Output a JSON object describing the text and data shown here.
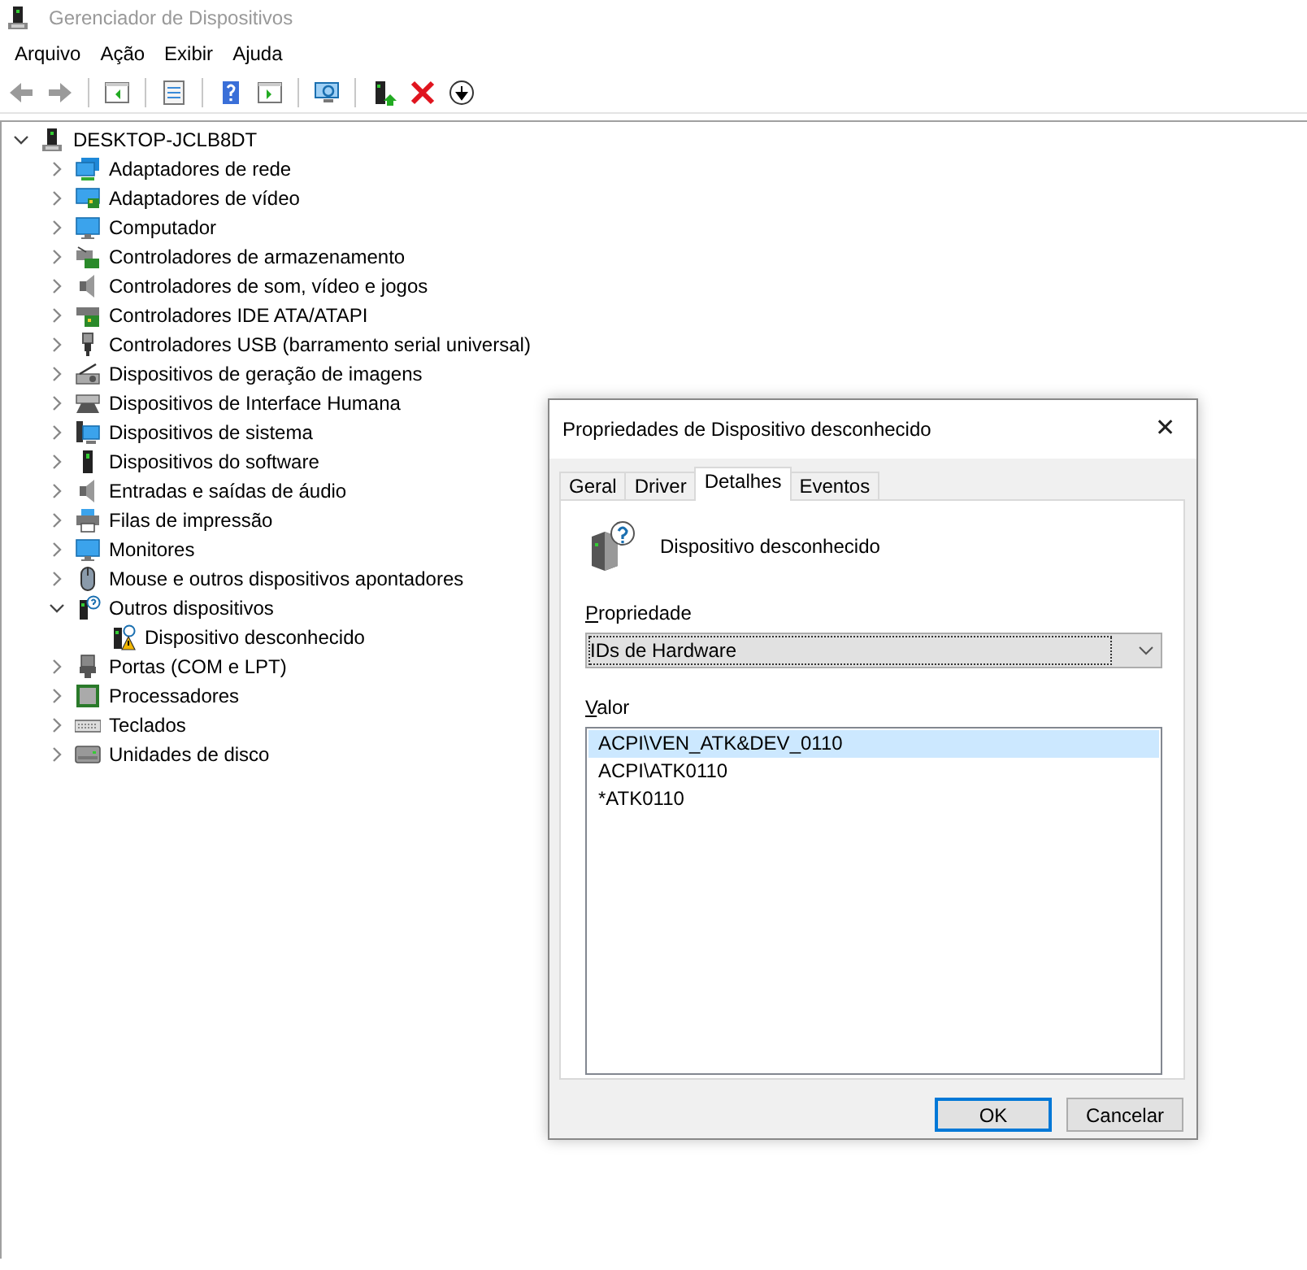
{
  "window": {
    "title": "Gerenciador de Dispositivos"
  },
  "menu": [
    "Arquivo",
    "Ação",
    "Exibir",
    "Ajuda"
  ],
  "tree": {
    "label": "DESKTOP-JCLB8DT",
    "expanded": true,
    "children": [
      {
        "label": "Adaptadores de rede",
        "expanded": false
      },
      {
        "label": "Adaptadores de vídeo",
        "expanded": false
      },
      {
        "label": "Computador",
        "expanded": false
      },
      {
        "label": "Controladores de armazenamento",
        "expanded": false
      },
      {
        "label": "Controladores de som, vídeo e jogos",
        "expanded": false
      },
      {
        "label": "Controladores IDE ATA/ATAPI",
        "expanded": false
      },
      {
        "label": "Controladores USB (barramento serial universal)",
        "expanded": false
      },
      {
        "label": "Dispositivos de geração de imagens",
        "expanded": false
      },
      {
        "label": "Dispositivos de Interface Humana",
        "expanded": false
      },
      {
        "label": "Dispositivos de sistema",
        "expanded": false
      },
      {
        "label": "Dispositivos do software",
        "expanded": false
      },
      {
        "label": "Entradas e saídas de áudio",
        "expanded": false
      },
      {
        "label": "Filas de impressão",
        "expanded": false
      },
      {
        "label": "Monitores",
        "expanded": false
      },
      {
        "label": "Mouse e outros dispositivos apontadores",
        "expanded": false
      },
      {
        "label": "Outros dispositivos",
        "expanded": true,
        "children": [
          {
            "label": "Dispositivo desconhecido"
          }
        ]
      },
      {
        "label": "Portas (COM e LPT)",
        "expanded": false
      },
      {
        "label": "Processadores",
        "expanded": false
      },
      {
        "label": "Teclados",
        "expanded": false
      },
      {
        "label": "Unidades de disco",
        "expanded": false
      }
    ]
  },
  "dialog": {
    "title": "Propriedades de Dispositivo desconhecido",
    "close": "✕",
    "tabs": [
      {
        "label": "Geral",
        "selected": false
      },
      {
        "label": "Driver",
        "selected": false
      },
      {
        "label": "Detalhes",
        "selected": true
      },
      {
        "label": "Eventos",
        "selected": false
      }
    ],
    "device_name": "Dispositivo desconhecido",
    "property_label": "Propriedade",
    "property_value": "IDs de Hardware",
    "value_label": "Valor",
    "values": [
      {
        "text": "ACPI\\VEN_ATK&DEV_0110",
        "selected": true
      },
      {
        "text": "ACPI\\ATK0110",
        "selected": false
      },
      {
        "text": "*ATK0110",
        "selected": false
      }
    ],
    "buttons": [
      {
        "label": "OK",
        "default": true
      },
      {
        "label": "Cancelar",
        "default": false
      }
    ]
  }
}
